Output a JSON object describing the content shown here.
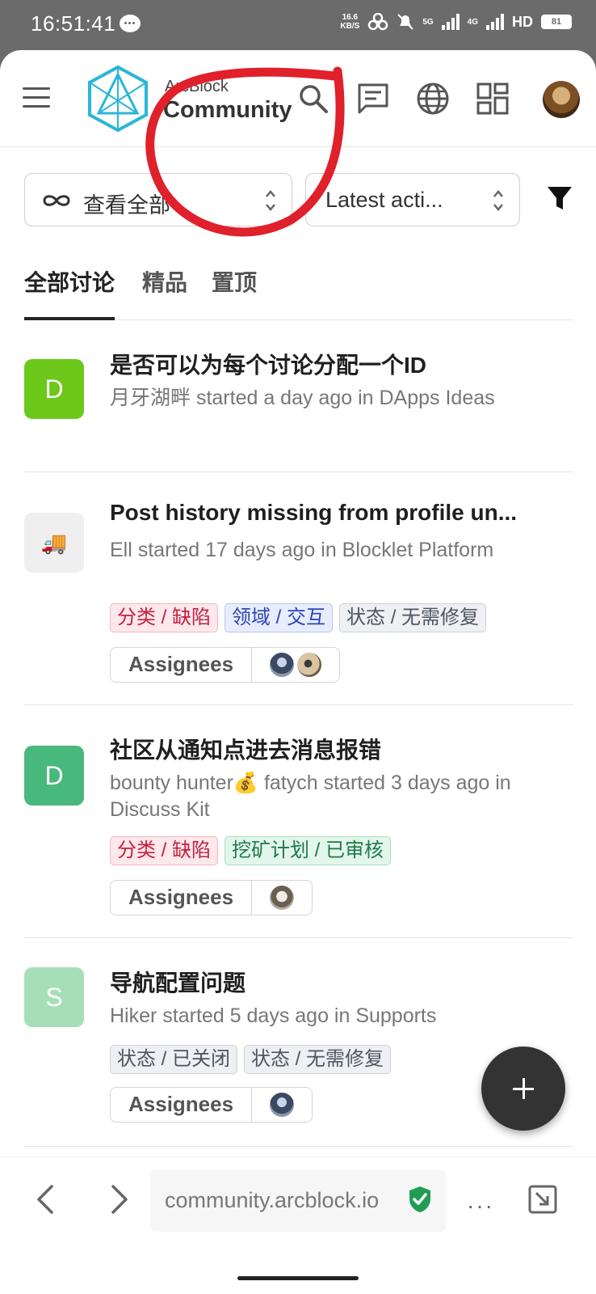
{
  "status_bar": {
    "time": "16:51:41",
    "speed": "16.6",
    "speed_unit": "KB/S",
    "network": "5G",
    "network2": "4G",
    "hd": "HD",
    "battery": "81"
  },
  "header": {
    "brand_top": "ArcBlock",
    "brand_main": "Community",
    "icons": [
      "menu-icon",
      "search-icon",
      "chat-icon",
      "globe-icon",
      "dashboard-icon"
    ]
  },
  "filters": {
    "scope_label": "查看全部",
    "sort_label": "Latest acti..."
  },
  "tabs": [
    {
      "label": "全部讨论",
      "active": true
    },
    {
      "label": "精品",
      "active": false
    },
    {
      "label": "置顶",
      "active": false
    }
  ],
  "discussions": [
    {
      "icon_letter": "D",
      "icon_color": "#6cc81b",
      "title": "是否可以为每个讨论分配一个ID",
      "meta": "月牙湖畔 started a day ago in DApps Ideas",
      "tags": []
    },
    {
      "icon_letter": "🚚",
      "icon_color": "#efefef",
      "title": "Post history missing from profile un...",
      "meta": "Ell started 17 days ago in Blocklet Platform",
      "tags": [
        {
          "text": "分类 / 缺陷",
          "style": "red"
        },
        {
          "text": "领域 / 交互",
          "style": "blue"
        },
        {
          "text": "状态 / 无需修复",
          "style": "gray"
        }
      ],
      "assignees_label": "Assignees"
    },
    {
      "icon_letter": "D",
      "icon_color": "#49b87c",
      "title": "社区从通知点进去消息报错",
      "meta": "bounty hunter💰 fatych started 3 days ago in Discuss Kit",
      "tags": [
        {
          "text": "分类 / 缺陷",
          "style": "red"
        },
        {
          "text": "挖矿计划 / 已审核",
          "style": "green"
        }
      ],
      "assignees_label": "Assignees"
    },
    {
      "icon_letter": "S",
      "icon_color": "#a6dfb6",
      "title": "导航配置问题",
      "meta": "Hiker started 5 days ago in Supports",
      "tags": [
        {
          "text": "状态 / 已关闭",
          "style": "gray"
        },
        {
          "text": "状态 / 无需修复",
          "style": "gray"
        }
      ],
      "assignees_label": "Assignees"
    }
  ],
  "browser": {
    "url": "community.arcblock.io",
    "more": "···"
  },
  "colors": {
    "annotation": "#e0202a",
    "logo": "#29b6d8",
    "fab": "#333333"
  }
}
